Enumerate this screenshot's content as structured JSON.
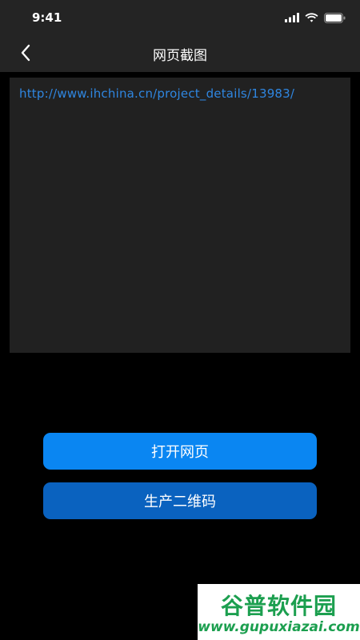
{
  "status_bar": {
    "time": "9:41",
    "icons": [
      "cellular-signal-icon",
      "wifi-icon",
      "battery-icon"
    ]
  },
  "nav": {
    "back_icon": "chevron-left-icon",
    "title": "网页截图"
  },
  "url_input": {
    "value": "http://www.ihchina.cn/project_details/13983/"
  },
  "buttons": {
    "open_label": "打开网页",
    "qr_label": "生产二维码"
  },
  "watermark": {
    "title": "谷普软件园",
    "url": "www.gupuxiazai.com"
  },
  "colors": {
    "background": "#000000",
    "header": "#242424",
    "input_bg": "#212121",
    "url_text": "#2f86e0",
    "button_primary": "#0a86f2",
    "button_secondary": "#0a62bf",
    "watermark": "#1c9f4f"
  }
}
